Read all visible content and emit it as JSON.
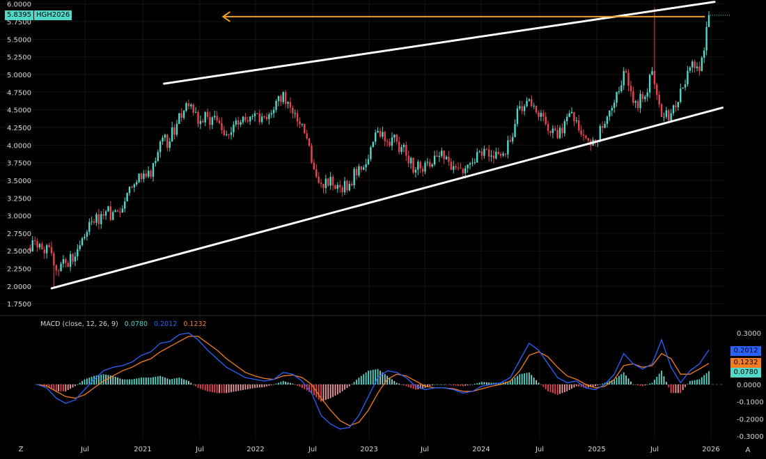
{
  "symbol": "HGH2026",
  "last_price": "5.8395",
  "macd_legend": {
    "title": "MACD (close, 12, 26, 9)",
    "histogram": "0.0780",
    "macd": "0.2012",
    "signal": "0.1232"
  },
  "colors": {
    "up": "#52d8c8",
    "down": "#e8434f",
    "macd": "#2962ff",
    "signal": "#f57c20",
    "trendline": "#ffffff",
    "level": "#f0a020",
    "background": "#000000"
  },
  "chart_data": [
    {
      "type": "candlestick",
      "title": "HGH2026",
      "start": "2020-01",
      "interval": "monthly anchor closes",
      "closes": [
        2.55,
        2.58,
        2.22,
        2.33,
        2.42,
        2.7,
        2.9,
        3.0,
        3.05,
        3.1,
        3.4,
        3.52,
        3.55,
        4.05,
        4.05,
        4.45,
        4.55,
        4.3,
        4.4,
        4.35,
        4.15,
        4.35,
        4.35,
        4.45,
        4.4,
        4.5,
        4.75,
        4.45,
        4.3,
        3.75,
        3.45,
        3.55,
        3.4,
        3.45,
        3.7,
        3.8,
        4.2,
        4.05,
        4.05,
        3.85,
        3.65,
        3.75,
        3.85,
        3.8,
        3.7,
        3.6,
        3.75,
        3.85,
        3.85,
        3.85,
        4.05,
        4.55,
        4.65,
        4.4,
        4.2,
        4.1,
        4.4,
        4.35,
        4.1,
        4.05,
        4.3,
        4.6,
        5.05,
        4.6,
        4.65,
        5.05,
        4.4,
        4.45,
        4.8,
        5.1,
        5.05,
        5.84
      ],
      "ylim": [
        1.75,
        6.0
      ],
      "y_ticks": [
        "6.0000",
        "5.7500",
        "5.5000",
        "5.2500",
        "5.0000",
        "4.7500",
        "4.5000",
        "4.2500",
        "4.0000",
        "3.7500",
        "3.5000",
        "3.2500",
        "3.0000",
        "2.7500",
        "2.5000",
        "2.2500",
        "2.0000",
        "1.7500"
      ],
      "x_ticks": [
        "Z",
        "Jul",
        "2021",
        "Jul",
        "2022",
        "Jul",
        "2023",
        "Jul",
        "2024",
        "Jul",
        "2025",
        "Jul",
        "2026"
      ],
      "trendlines": [
        {
          "name": "upper-channel",
          "from": [
            2021.2,
            4.87
          ],
          "to": [
            2026.05,
            6.03
          ]
        },
        {
          "name": "lower-channel",
          "from": [
            2020.21,
            1.97
          ],
          "to": [
            2026.12,
            4.53
          ]
        },
        {
          "name": "resistance-level",
          "from": [
            2021.72,
            5.82
          ],
          "to": [
            2025.96,
            5.82
          ]
        }
      ]
    },
    {
      "type": "line",
      "title": "MACD (close, 12, 26, 9)",
      "start": "2020-01",
      "series": [
        {
          "name": "MACD",
          "values": [
            0.0,
            -0.02,
            -0.08,
            -0.11,
            -0.09,
            -0.03,
            0.03,
            0.08,
            0.1,
            0.11,
            0.13,
            0.17,
            0.19,
            0.24,
            0.25,
            0.29,
            0.3,
            0.26,
            0.2,
            0.15,
            0.1,
            0.07,
            0.04,
            0.03,
            0.02,
            0.03,
            0.07,
            0.06,
            0.02,
            -0.05,
            -0.18,
            -0.23,
            -0.26,
            -0.25,
            -0.18,
            -0.07,
            0.04,
            0.08,
            0.07,
            0.04,
            -0.01,
            -0.03,
            -0.02,
            -0.02,
            -0.03,
            -0.05,
            -0.04,
            -0.01,
            0.0,
            0.01,
            0.04,
            0.14,
            0.24,
            0.2,
            0.12,
            0.04,
            0.01,
            0.02,
            -0.02,
            -0.03,
            0.0,
            0.06,
            0.18,
            0.12,
            0.09,
            0.12,
            0.26,
            0.1,
            0.01,
            0.08,
            0.12,
            0.2012
          ]
        },
        {
          "name": "Signal",
          "values": [
            0.0,
            -0.01,
            -0.04,
            -0.07,
            -0.08,
            -0.06,
            -0.02,
            0.02,
            0.05,
            0.08,
            0.1,
            0.13,
            0.15,
            0.19,
            0.22,
            0.25,
            0.28,
            0.28,
            0.24,
            0.2,
            0.15,
            0.11,
            0.07,
            0.05,
            0.035,
            0.03,
            0.05,
            0.055,
            0.04,
            0.0,
            -0.08,
            -0.15,
            -0.21,
            -0.24,
            -0.22,
            -0.15,
            -0.05,
            0.03,
            0.06,
            0.05,
            0.02,
            -0.01,
            -0.02,
            -0.02,
            -0.025,
            -0.04,
            -0.04,
            -0.025,
            -0.01,
            0.0,
            0.02,
            0.08,
            0.17,
            0.19,
            0.16,
            0.1,
            0.05,
            0.03,
            0.0,
            -0.02,
            -0.01,
            0.03,
            0.11,
            0.12,
            0.1,
            0.11,
            0.18,
            0.15,
            0.06,
            0.06,
            0.09,
            0.1232
          ]
        }
      ],
      "histogram_last": 0.078,
      "ylim": [
        -0.3,
        0.3
      ],
      "y_ticks": [
        "0.3000",
        "0.0000",
        "-0.1000",
        "-0.2000",
        "-0.3000"
      ],
      "value_tags": [
        "0.2012",
        "0.1232",
        "0.0780"
      ]
    }
  ],
  "auto_scale_label": "A"
}
